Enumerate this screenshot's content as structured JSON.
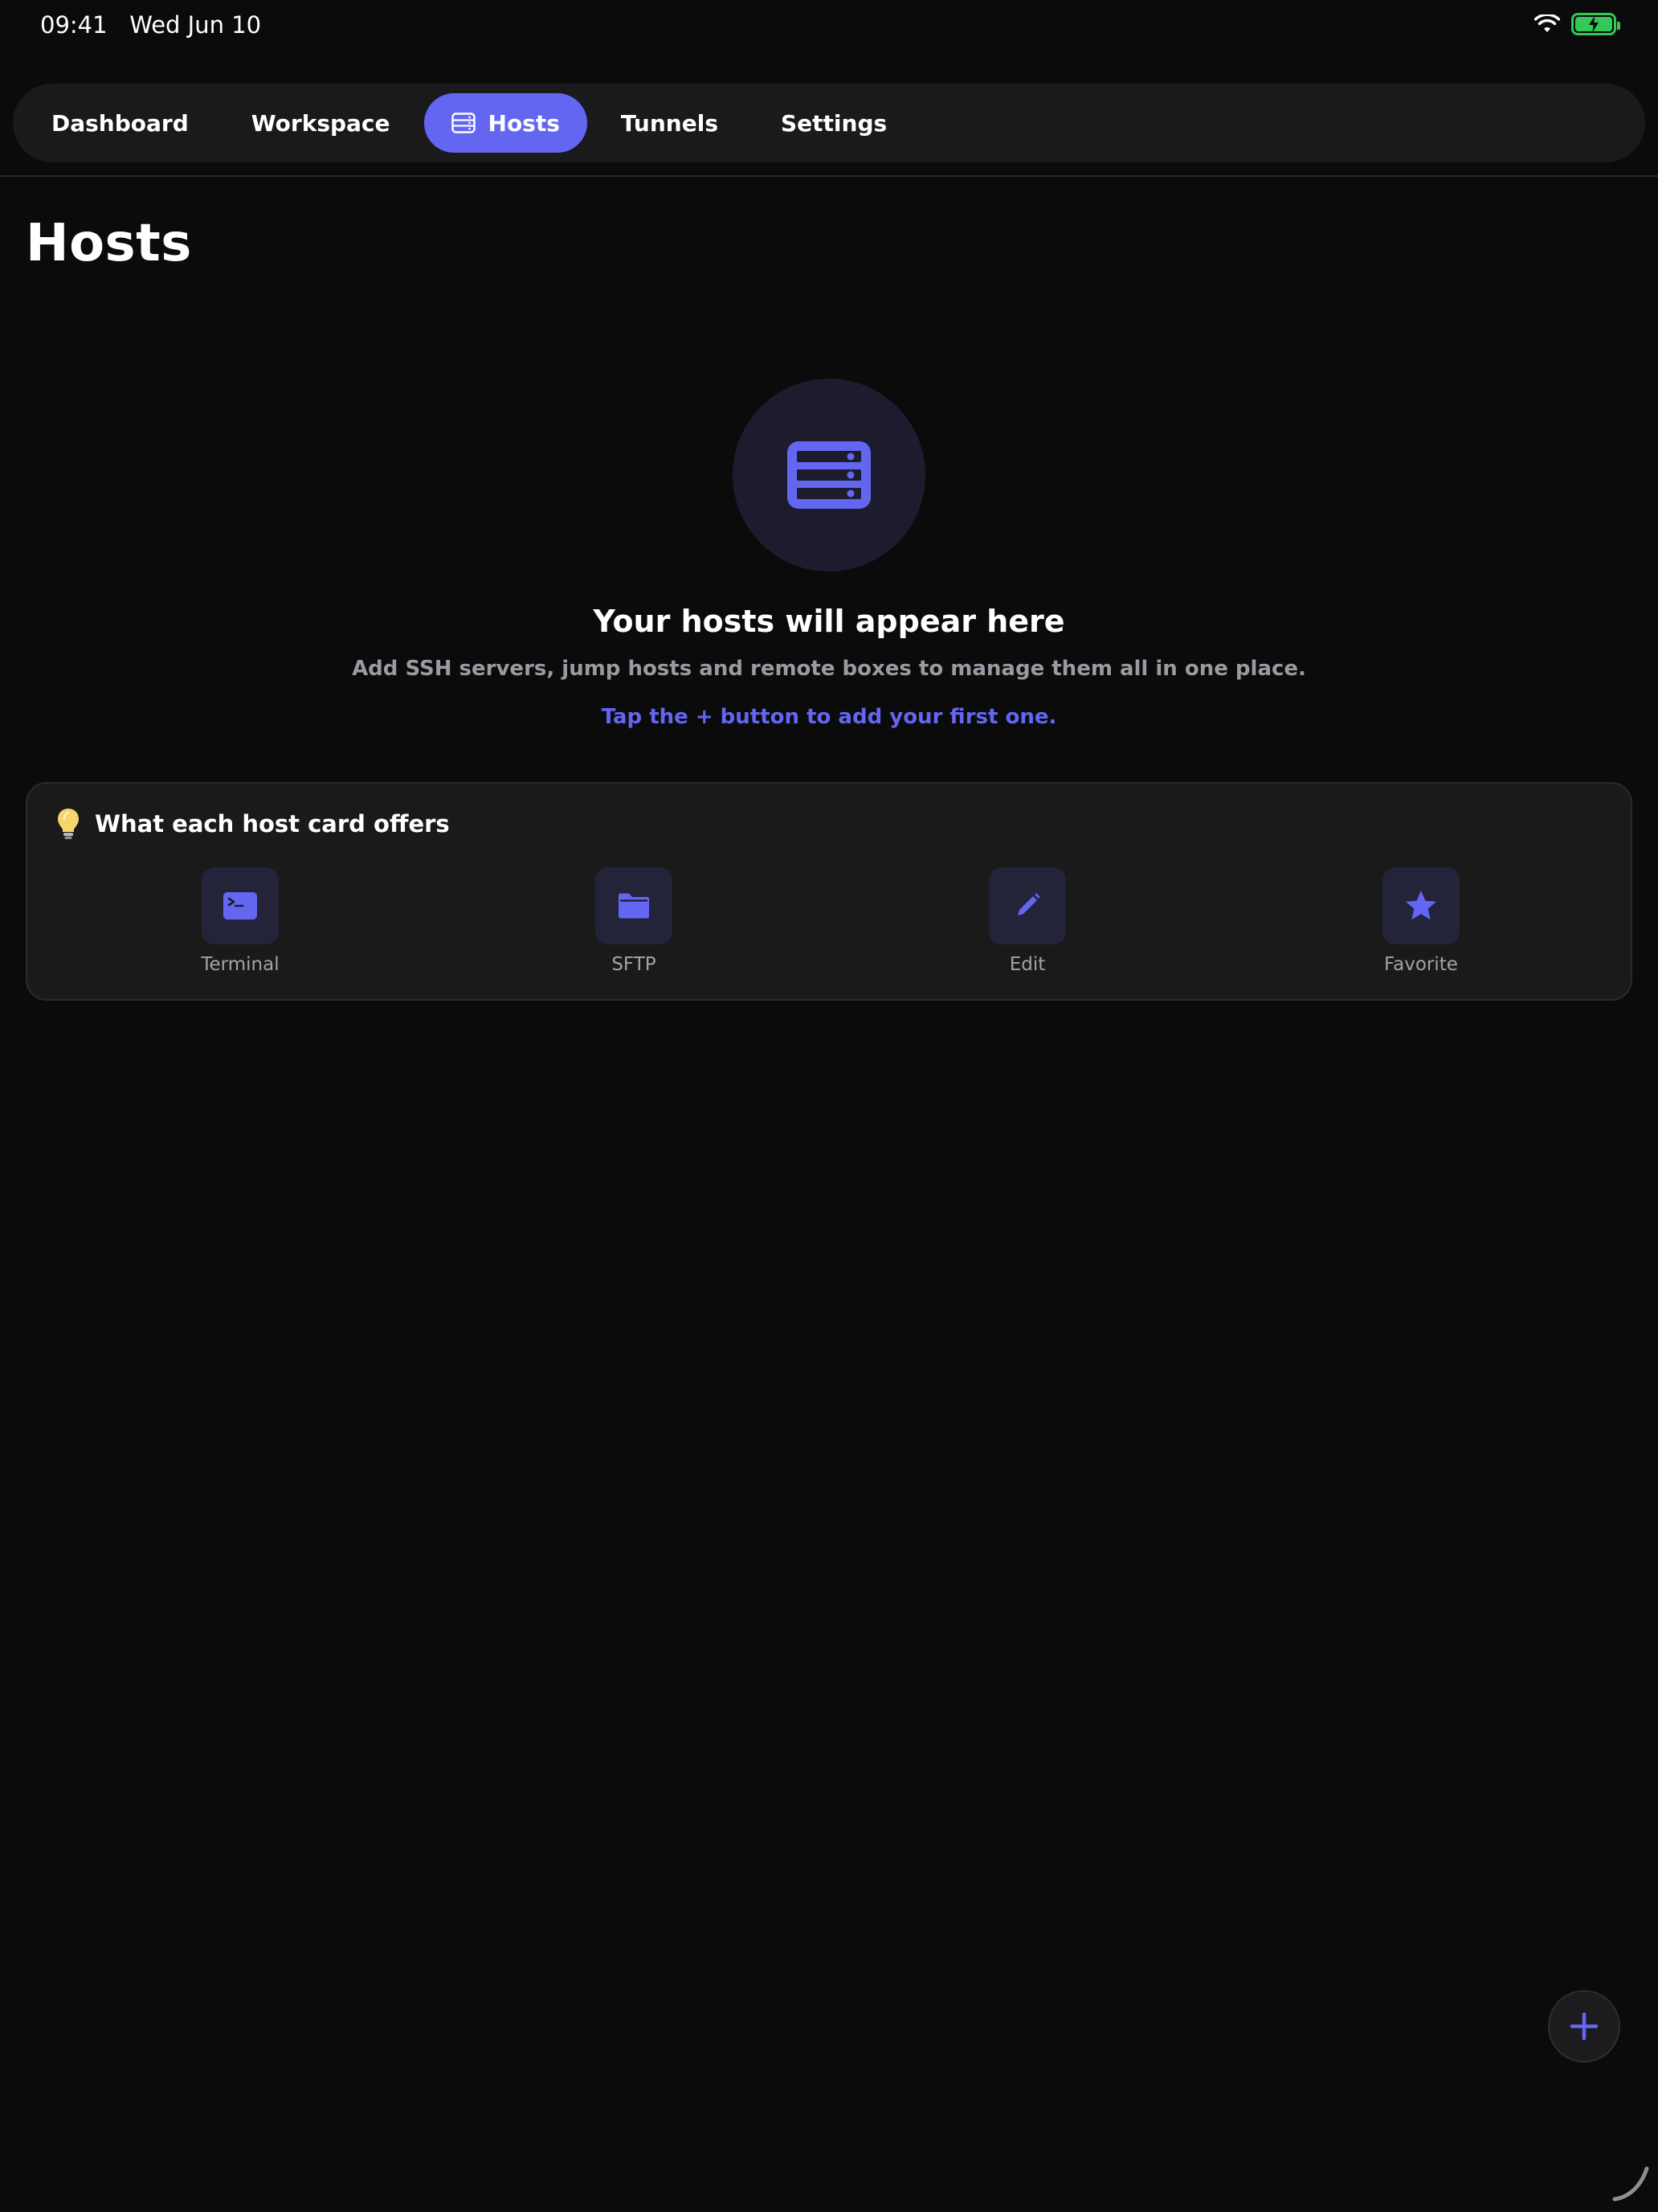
{
  "status_bar": {
    "time": "09:41",
    "date": "Wed Jun 10",
    "battery_color": "#34c759"
  },
  "tabs": [
    {
      "label": "Dashboard",
      "active": false
    },
    {
      "label": "Workspace",
      "active": false
    },
    {
      "label": "Hosts",
      "active": true,
      "icon": "server-icon"
    },
    {
      "label": "Tunnels",
      "active": false
    },
    {
      "label": "Settings",
      "active": false
    }
  ],
  "page": {
    "title": "Hosts"
  },
  "empty_state": {
    "icon": "server-icon",
    "title": "Your hosts will appear here",
    "subtitle": "Add SSH servers, jump hosts and remote boxes to manage them all in one place.",
    "hint": "Tap the + button to add your first one."
  },
  "info_card": {
    "icon": "lightbulb-icon",
    "title": "What each host card offers",
    "features": [
      {
        "label": "Terminal",
        "icon": "terminal-icon"
      },
      {
        "label": "SFTP",
        "icon": "folder-icon"
      },
      {
        "label": "Edit",
        "icon": "pencil-icon"
      },
      {
        "label": "Favorite",
        "icon": "star-icon"
      }
    ]
  },
  "fab": {
    "icon": "plus-icon"
  },
  "colors": {
    "accent": "#6366f1",
    "background": "#0b0b0c",
    "card": "#1a1a1b",
    "muted_text": "#9a9aa2"
  }
}
